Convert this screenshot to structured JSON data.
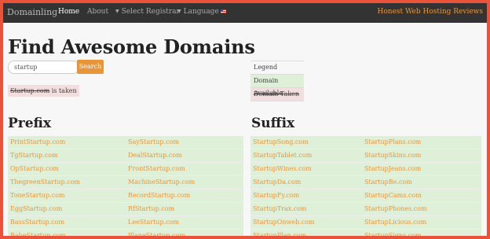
{
  "navbar": {
    "brand": "Domainling",
    "items": [
      {
        "label": "Home"
      },
      {
        "label": "About"
      },
      {
        "label": "Select Registrar"
      },
      {
        "label": "Language"
      }
    ],
    "right_link": "Honest Web Hosting Reviews"
  },
  "page_title": "Find Awesome Domains",
  "search": {
    "value": "startup",
    "button_label": "Search"
  },
  "taken_message": {
    "domain": "Startup.com",
    "suffix": " is taken"
  },
  "legend": {
    "title": "Legend",
    "available": "Domain Available",
    "taken": "Domain Taken"
  },
  "prefix": {
    "heading": "Prefix",
    "rows": [
      [
        "PrintStartup.com",
        "SayStartup.com"
      ],
      [
        "TgStartup.com",
        "DealStartup.com"
      ],
      [
        "OpStartup.com",
        "FrontStartup.com"
      ],
      [
        "ThegreenStartup.com",
        "MachineStartup.com"
      ],
      [
        "ToneStartup.com",
        "RecordStartup.com"
      ],
      [
        "EggStartup.com",
        "RfStartup.com"
      ],
      [
        "BassStartup.com",
        "LeeStartup.com"
      ],
      [
        "BabeStartup.com",
        "PlaneStartup.com"
      ]
    ]
  },
  "suffix": {
    "heading": "Suffix",
    "rows": [
      [
        "StartupSong.com",
        "StartupPlans.com"
      ],
      [
        "StartupTablet.com",
        "StartupSkins.com"
      ],
      [
        "StartupWines.com",
        "StartupJeans.com"
      ],
      [
        "StartupDa.com",
        "StartupBe.com"
      ],
      [
        "StartupFy.com",
        "StartupCams.com"
      ],
      [
        "StartupTrax.com",
        "StartupPhones.com"
      ],
      [
        "StartupOnweb.com",
        "StartupLicious.com"
      ],
      [
        "StartupPlan.com",
        "StartupSigns.com"
      ]
    ]
  }
}
